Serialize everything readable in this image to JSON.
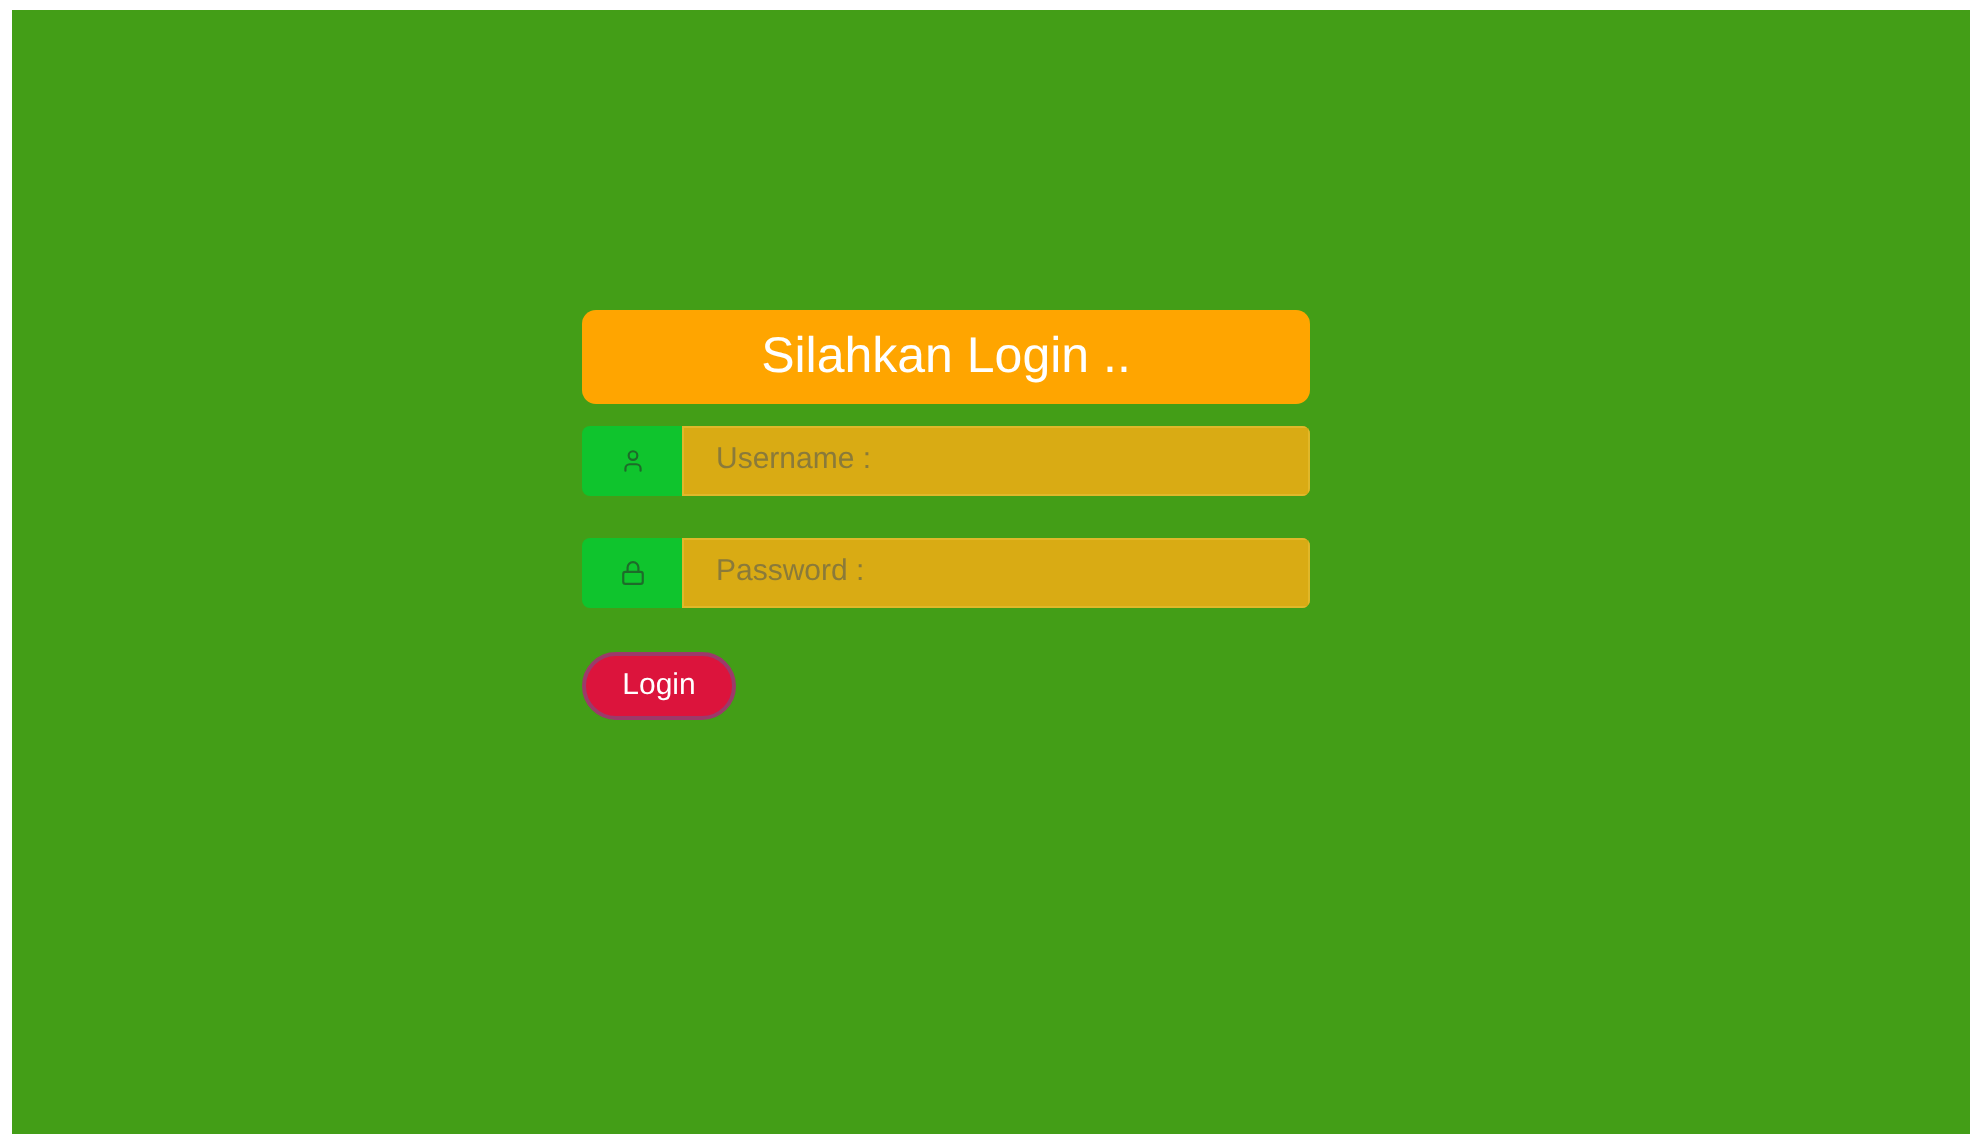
{
  "title": "Silahkan Login ..",
  "fields": [
    {
      "kind": "user",
      "placeholder": "Username :"
    },
    {
      "kind": "lock",
      "placeholder": "Password :"
    }
  ],
  "button": "Login"
}
